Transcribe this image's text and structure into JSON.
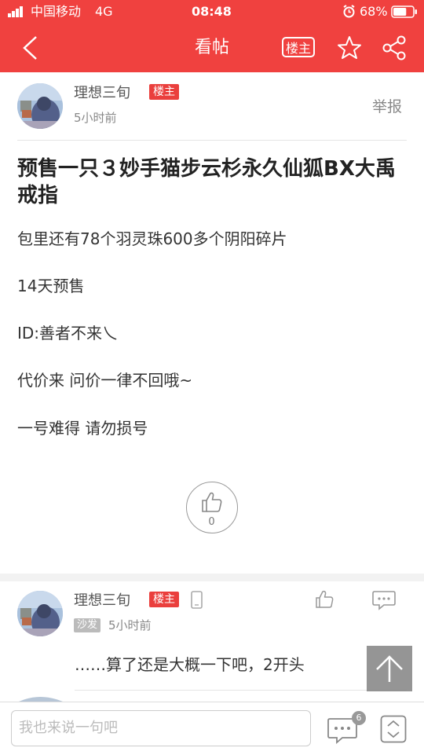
{
  "status_bar": {
    "carrier": "中国移动",
    "network": "4G",
    "time": "08:48",
    "battery": "68%",
    "battery_level": 0.68
  },
  "nav": {
    "title": "看帖",
    "op_label": "楼主",
    "icons": [
      "back-arrow-icon",
      "star-icon",
      "share-icon"
    ]
  },
  "post": {
    "author": "理想三旬",
    "author_badge": "楼主",
    "time": "5小时前",
    "report_label": "举报",
    "title": "预售一只３妙手猫步云杉永久仙狐BX大禹戒指",
    "paragraphs": [
      "包里还有78个羽灵珠600多个阴阳碎片",
      "14天预售",
      "ID:善者不来乀",
      "代价来 问价一律不回哦~",
      "一号难得 请勿损号"
    ],
    "likes": "0"
  },
  "reply": {
    "author": "理想三旬",
    "author_badge": "楼主",
    "floor": "沙发",
    "time": "5小时前",
    "text": "……算了还是大概一下吧，2开头"
  },
  "bottom_bar": {
    "input_placeholder": "我也来说一句吧",
    "comment_count": "6"
  },
  "colors": {
    "brand_red": "#f0413f",
    "badge_red": "#ea3f3d",
    "text": "#333333",
    "muted": "#888888"
  }
}
